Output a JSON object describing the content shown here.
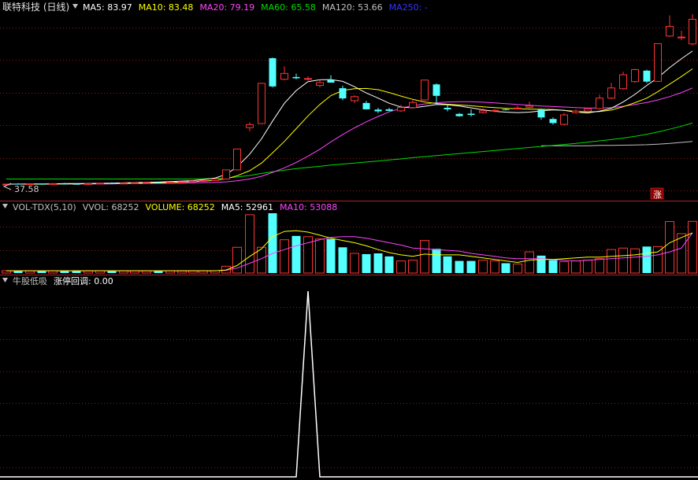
{
  "price_panel": {
    "title": "联特科技 (日线)",
    "ma_labels": [
      {
        "text": "MA5: 83.97",
        "color": "#ffffff"
      },
      {
        "text": "MA10: 83.48",
        "color": "#ffff00"
      },
      {
        "text": "MA20: 79.19",
        "color": "#ff44ff"
      },
      {
        "text": "MA60: 65.58",
        "color": "#00dd00"
      },
      {
        "text": "MA120: 53.66",
        "color": "#c0c0c0"
      },
      {
        "text": "MA250: -",
        "color": "#3333ff"
      }
    ],
    "low_label": "37.58",
    "limit_up_badge": "涨"
  },
  "volume_panel": {
    "labels": [
      {
        "text": "VOL-TDX(5,10)",
        "color": "#c0c0c0"
      },
      {
        "text": "VVOL: 68252",
        "color": "#c0c0c0"
      },
      {
        "text": "VOLUME: 68252",
        "color": "#ffff00"
      },
      {
        "text": "MA5: 52961",
        "color": "#ffffff"
      },
      {
        "text": "MA10: 53088",
        "color": "#ff44ff"
      }
    ]
  },
  "signal_panel": {
    "labels": [
      {
        "text": "牛股低吸",
        "color": "#c0c0c0"
      },
      {
        "text": "涨停回调: 0.00",
        "color": "#ffffff"
      }
    ]
  },
  "colors": {
    "up": "#ff3333",
    "down": "#54ffff",
    "grid": "#8b1a1a",
    "separator": "#b22222",
    "ma5": "#ffffff",
    "ma10": "#ffff00",
    "ma20": "#ff44ff",
    "ma60": "#00dd00",
    "ma120": "#c0c0c0"
  },
  "chart_data": {
    "type": "candlestick",
    "price_range": [
      37.58,
      105
    ],
    "candles": [
      {
        "o": 38.1,
        "h": 38.4,
        "l": 37.58,
        "c": 38.2
      },
      {
        "o": 38.4,
        "h": 38.6,
        "l": 38.0,
        "c": 38.2
      },
      {
        "o": 38.2,
        "h": 38.4,
        "l": 37.9,
        "c": 38.3
      },
      {
        "o": 38.3,
        "h": 38.5,
        "l": 38.0,
        "c": 38.2
      },
      {
        "o": 38.2,
        "h": 38.6,
        "l": 38.0,
        "c": 38.4
      },
      {
        "o": 38.4,
        "h": 38.7,
        "l": 38.1,
        "c": 38.3
      },
      {
        "o": 38.3,
        "h": 38.6,
        "l": 38.0,
        "c": 38.2
      },
      {
        "o": 38.2,
        "h": 38.5,
        "l": 37.9,
        "c": 38.4
      },
      {
        "o": 38.4,
        "h": 38.8,
        "l": 38.2,
        "c": 38.6
      },
      {
        "o": 38.6,
        "h": 38.9,
        "l": 38.3,
        "c": 38.5
      },
      {
        "o": 38.5,
        "h": 38.8,
        "l": 38.3,
        "c": 38.6
      },
      {
        "o": 38.6,
        "h": 38.9,
        "l": 38.4,
        "c": 38.7
      },
      {
        "o": 38.7,
        "h": 39.0,
        "l": 38.5,
        "c": 38.8
      },
      {
        "o": 38.8,
        "h": 39.1,
        "l": 38.5,
        "c": 38.7
      },
      {
        "o": 38.7,
        "h": 39.0,
        "l": 38.5,
        "c": 38.9
      },
      {
        "o": 38.9,
        "h": 39.3,
        "l": 38.7,
        "c": 39.1
      },
      {
        "o": 39.1,
        "h": 39.6,
        "l": 38.9,
        "c": 39.4
      },
      {
        "o": 39.4,
        "h": 39.8,
        "l": 39.1,
        "c": 39.6
      },
      {
        "o": 39.6,
        "h": 40.5,
        "l": 39.4,
        "c": 40.2
      },
      {
        "o": 40.2,
        "h": 43.8,
        "l": 40.0,
        "c": 43.8
      },
      {
        "o": 43.8,
        "h": 52.0,
        "l": 43.6,
        "c": 52.0
      },
      {
        "o": 60.4,
        "h": 62.5,
        "l": 59.0,
        "c": 61.6
      },
      {
        "o": 62.0,
        "h": 78.0,
        "l": 61.8,
        "c": 77.8
      },
      {
        "o": 87.7,
        "h": 87.9,
        "l": 76.2,
        "c": 76.6
      },
      {
        "o": 79.4,
        "h": 84.5,
        "l": 79.0,
        "c": 81.7
      },
      {
        "o": 80.3,
        "h": 81.6,
        "l": 79.4,
        "c": 79.8
      },
      {
        "o": 79.6,
        "h": 80.6,
        "l": 78.9,
        "c": 79.7
      },
      {
        "o": 77.0,
        "h": 79.2,
        "l": 76.2,
        "c": 78.1
      },
      {
        "o": 79.1,
        "h": 81.0,
        "l": 78.2,
        "c": 78.1
      },
      {
        "o": 75.9,
        "h": 76.9,
        "l": 71.2,
        "c": 71.9
      },
      {
        "o": 71.0,
        "h": 73.1,
        "l": 70.1,
        "c": 72.6
      },
      {
        "o": 70.1,
        "h": 70.9,
        "l": 67.5,
        "c": 67.6
      },
      {
        "o": 67.5,
        "h": 68.2,
        "l": 66.1,
        "c": 66.8
      },
      {
        "o": 67.6,
        "h": 68.2,
        "l": 66.8,
        "c": 67.0
      },
      {
        "o": 67.0,
        "h": 69.4,
        "l": 66.6,
        "c": 68.3
      },
      {
        "o": 68.3,
        "h": 71.2,
        "l": 68.0,
        "c": 70.3
      },
      {
        "o": 71.3,
        "h": 79.3,
        "l": 71.0,
        "c": 79.1
      },
      {
        "o": 77.4,
        "h": 77.8,
        "l": 69.4,
        "c": 72.9
      },
      {
        "o": 68.2,
        "h": 69.4,
        "l": 66.8,
        "c": 67.6
      },
      {
        "o": 65.8,
        "h": 66.2,
        "l": 64.7,
        "c": 64.9
      },
      {
        "o": 65.9,
        "h": 67.6,
        "l": 64.7,
        "c": 65.4
      },
      {
        "o": 66.3,
        "h": 68.0,
        "l": 65.9,
        "c": 67.0
      },
      {
        "o": 67.0,
        "h": 67.6,
        "l": 66.4,
        "c": 67.2
      },
      {
        "o": 67.6,
        "h": 68.0,
        "l": 67.2,
        "c": 67.4
      },
      {
        "o": 67.9,
        "h": 69.0,
        "l": 67.5,
        "c": 68.1
      },
      {
        "o": 68.4,
        "h": 70.6,
        "l": 68.0,
        "c": 68.9
      },
      {
        "o": 67.5,
        "h": 67.9,
        "l": 63.5,
        "c": 64.4
      },
      {
        "o": 63.8,
        "h": 64.4,
        "l": 61.6,
        "c": 62.2
      },
      {
        "o": 61.7,
        "h": 66.2,
        "l": 61.3,
        "c": 65.4
      },
      {
        "o": 66.3,
        "h": 67.6,
        "l": 65.9,
        "c": 66.9
      },
      {
        "o": 66.9,
        "h": 68.3,
        "l": 66.4,
        "c": 67.8
      },
      {
        "o": 67.9,
        "h": 73.3,
        "l": 67.5,
        "c": 72.0
      },
      {
        "o": 72.0,
        "h": 78.0,
        "l": 71.6,
        "c": 76.0
      },
      {
        "o": 75.7,
        "h": 82.4,
        "l": 75.3,
        "c": 81.2
      },
      {
        "o": 78.5,
        "h": 83.6,
        "l": 78.1,
        "c": 83.2
      },
      {
        "o": 82.8,
        "h": 83.2,
        "l": 77.9,
        "c": 78.5
      },
      {
        "o": 78.6,
        "h": 93.5,
        "l": 78.4,
        "c": 93.4
      },
      {
        "o": 96.4,
        "h": 104.5,
        "l": 96.0,
        "c": 100.2
      },
      {
        "o": 96.0,
        "h": 98.5,
        "l": 94.7,
        "c": 96.0
      },
      {
        "o": 93.3,
        "h": 105.0,
        "l": 92.8,
        "c": 103.0
      }
    ],
    "candle_x": [
      8,
      23,
      38,
      53,
      67,
      82,
      97,
      112,
      127,
      142,
      157,
      171,
      186,
      201,
      216,
      231,
      245,
      258,
      273,
      287,
      301,
      317,
      332,
      346,
      361,
      376,
      391,
      406,
      420,
      435,
      450,
      465,
      480,
      494,
      509,
      524,
      539,
      554,
      568,
      583,
      598,
      613,
      628,
      642,
      657,
      672,
      687,
      702,
      716,
      731,
      746,
      761,
      776,
      791,
      806,
      821,
      835,
      850,
      865,
      879
    ],
    "ma5": [
      38.2,
      38.2,
      38.3,
      38.3,
      38.3,
      38.4,
      38.4,
      38.4,
      38.5,
      38.6,
      38.7,
      38.8,
      38.9,
      39.0,
      39.2,
      39.4,
      39.6,
      40.0,
      40.6,
      42.0,
      45.0,
      50.0,
      56.0,
      63.0,
      70.0,
      75.0,
      78.5,
      79.2,
      79.3,
      78.6,
      76.5,
      74.0,
      72.0,
      70.0,
      68.5,
      68.2,
      68.8,
      69.5,
      69.4,
      68.9,
      68.2,
      67.4,
      66.8,
      66.5,
      66.3,
      66.5,
      67.0,
      67.4,
      67.2,
      66.5,
      66.2,
      66.9,
      68.0,
      70.5,
      73.5,
      77.0,
      80.0,
      84.0,
      87.5,
      90.5
    ],
    "ma10": [
      38.2,
      38.2,
      38.2,
      38.2,
      38.3,
      38.3,
      38.3,
      38.4,
      38.4,
      38.5,
      38.6,
      38.6,
      38.7,
      38.8,
      38.9,
      39.0,
      39.2,
      39.4,
      39.7,
      40.3,
      41.5,
      43.5,
      46.5,
      50.5,
      55.0,
      60.0,
      65.0,
      69.5,
      73.0,
      75.0,
      75.7,
      75.8,
      75.3,
      74.2,
      72.8,
      71.5,
      70.5,
      69.9,
      69.6,
      69.3,
      69.0,
      68.6,
      68.3,
      68.0,
      67.8,
      67.7,
      67.6,
      67.5,
      67.2,
      66.8,
      66.6,
      66.7,
      67.3,
      68.6,
      70.2,
      72.0,
      74.5,
      77.5,
      80.5,
      83.5
    ],
    "ma20": [
      38.2,
      38.2,
      38.2,
      38.2,
      38.2,
      38.3,
      38.3,
      38.3,
      38.3,
      38.3,
      38.4,
      38.4,
      38.4,
      38.5,
      38.5,
      38.6,
      38.7,
      38.8,
      38.9,
      39.1,
      39.5,
      40.2,
      41.3,
      42.8,
      44.6,
      46.7,
      49.2,
      51.9,
      54.8,
      57.7,
      60.3,
      62.7,
      64.8,
      66.6,
      68.0,
      69.0,
      69.7,
      70.2,
      70.5,
      70.6,
      70.6,
      70.4,
      70.1,
      69.8,
      69.5,
      69.2,
      68.9,
      68.7,
      68.5,
      68.3,
      68.1,
      68.1,
      68.3,
      68.8,
      69.5,
      70.3,
      71.3,
      72.6,
      74.2,
      76.0
    ],
    "ma60": [
      40.2,
      40.2,
      40.2,
      40.2,
      40.2,
      40.2,
      40.2,
      40.2,
      40.2,
      40.2,
      40.2,
      40.2,
      40.2,
      40.2,
      40.2,
      40.2,
      40.2,
      40.3,
      40.4,
      40.6,
      41.0,
      41.6,
      42.4,
      43.1,
      43.7,
      44.3,
      44.8,
      45.2,
      45.7,
      46.1,
      46.5,
      46.9,
      47.3,
      47.7,
      48.1,
      48.6,
      49.0,
      49.4,
      49.8,
      50.2,
      50.6,
      51.0,
      51.4,
      51.8,
      52.2,
      52.6,
      53.0,
      53.4,
      53.8,
      54.2,
      54.7,
      55.2,
      55.7,
      56.3,
      57.0,
      57.8,
      58.7,
      59.8,
      61.0,
      62.2
    ],
    "ma120": {
      "from_index": 46,
      "values": [
        53.3,
        53.3,
        53.3,
        53.3,
        53.3,
        53.4,
        53.4,
        53.5,
        53.6,
        53.7,
        53.9,
        54.2,
        54.6,
        55.0
      ]
    },
    "limit_up_at_index": 56,
    "volume": {
      "range": [
        0,
        80000
      ],
      "values": [
        3100,
        3000,
        2900,
        2900,
        3000,
        3000,
        2900,
        2900,
        3100,
        3100,
        2900,
        3000,
        2900,
        2900,
        3000,
        2800,
        2900,
        3000,
        3100,
        9000,
        34000,
        77000,
        34000,
        79000,
        44000,
        49000,
        48000,
        45000,
        45000,
        34000,
        26000,
        25000,
        26000,
        22000,
        16000,
        17000,
        43000,
        32000,
        22000,
        16000,
        16000,
        17000,
        16000,
        13000,
        12000,
        28000,
        23000,
        17000,
        15000,
        16000,
        17000,
        19000,
        31000,
        33000,
        32000,
        35000,
        35000,
        68000,
        52000,
        68252
      ],
      "ma5": [
        3000,
        3000,
        3000,
        3000,
        3000,
        3000,
        3000,
        3000,
        3000,
        3000,
        3000,
        3000,
        3000,
        3000,
        3000,
        3000,
        3000,
        3000,
        3000,
        4000,
        10000,
        22000,
        32000,
        48000,
        55000,
        56000,
        54000,
        50000,
        46000,
        43000,
        40000,
        36000,
        31000,
        27000,
        24000,
        22000,
        25000,
        24000,
        24000,
        24000,
        22000,
        20000,
        18000,
        16000,
        14000,
        17000,
        18000,
        18000,
        19000,
        20000,
        21000,
        21000,
        22000,
        23000,
        24000,
        26000,
        28000,
        40000,
        47000,
        52961
      ],
      "ma10": [
        3000,
        3000,
        3000,
        3000,
        3000,
        3000,
        3000,
        3000,
        3000,
        3000,
        3000,
        3000,
        3000,
        3000,
        3000,
        3000,
        3000,
        3000,
        3000,
        3500,
        6500,
        13000,
        19000,
        26000,
        31000,
        36000,
        40000,
        44000,
        47000,
        48000,
        48000,
        46000,
        43000,
        40000,
        37000,
        33000,
        32000,
        31000,
        30000,
        29000,
        26000,
        24000,
        22000,
        20000,
        19000,
        19000,
        19000,
        18000,
        17000,
        16000,
        17000,
        18000,
        19000,
        20000,
        21000,
        22000,
        24000,
        28000,
        33000,
        53088
      ]
    },
    "signal": {
      "range": [
        0,
        1
      ],
      "x": [
        0,
        376,
        391,
        406,
        886
      ],
      "y": [
        0,
        0,
        1,
        0,
        0
      ]
    }
  }
}
